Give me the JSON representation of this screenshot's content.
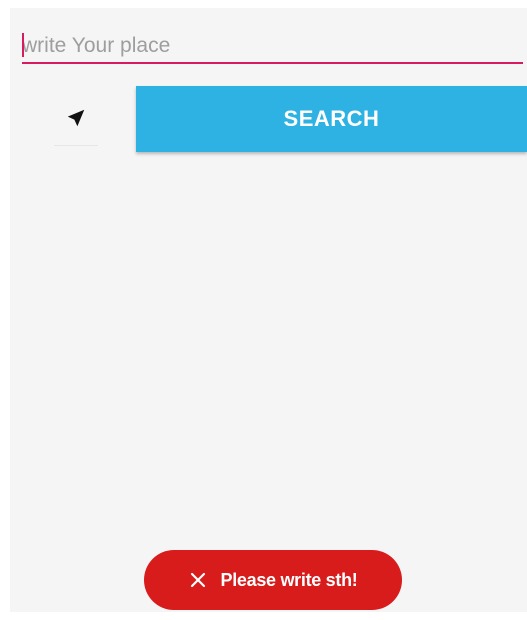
{
  "search": {
    "placeholder": "write Your place",
    "value": ""
  },
  "location_button": {
    "icon": "navigation-arrow-icon"
  },
  "search_button": {
    "label": "SEARCH"
  },
  "toast": {
    "icon": "close-icon",
    "message": "Please write sth!"
  },
  "colors": {
    "accent": "#d81b60",
    "primary": "#2eb2e4",
    "error": "#d81b1b",
    "background": "#f5f5f5"
  }
}
